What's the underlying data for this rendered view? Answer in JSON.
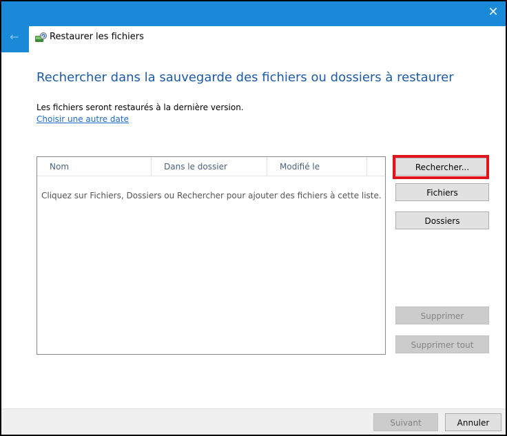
{
  "window": {
    "close_glyph": "✕",
    "back_glyph": "←",
    "title": "Restaurer les fichiers",
    "icon": "backup-restore-icon"
  },
  "main": {
    "heading": "Rechercher dans la sauvegarde des fichiers ou dossiers à restaurer",
    "info": "Les fichiers seront restaurés à la dernière version.",
    "alt_date_link": "Choisir une autre date"
  },
  "table": {
    "columns": [
      "Nom",
      "Dans le dossier",
      "Modifié le"
    ],
    "empty_message": "Cliquez sur Fichiers, Dossiers ou Rechercher pour ajouter des fichiers à cette liste."
  },
  "buttons": {
    "search": "Rechercher...",
    "files": "Fichiers",
    "folders": "Dossiers",
    "remove": "Supprimer",
    "remove_all": "Supprimer tout"
  },
  "footer": {
    "next": "Suivant",
    "cancel": "Annuler"
  },
  "colors": {
    "accent": "#1a8ad8",
    "heading": "#1c5aa8",
    "link": "#1b6ac9",
    "highlight": "#e0131f"
  }
}
